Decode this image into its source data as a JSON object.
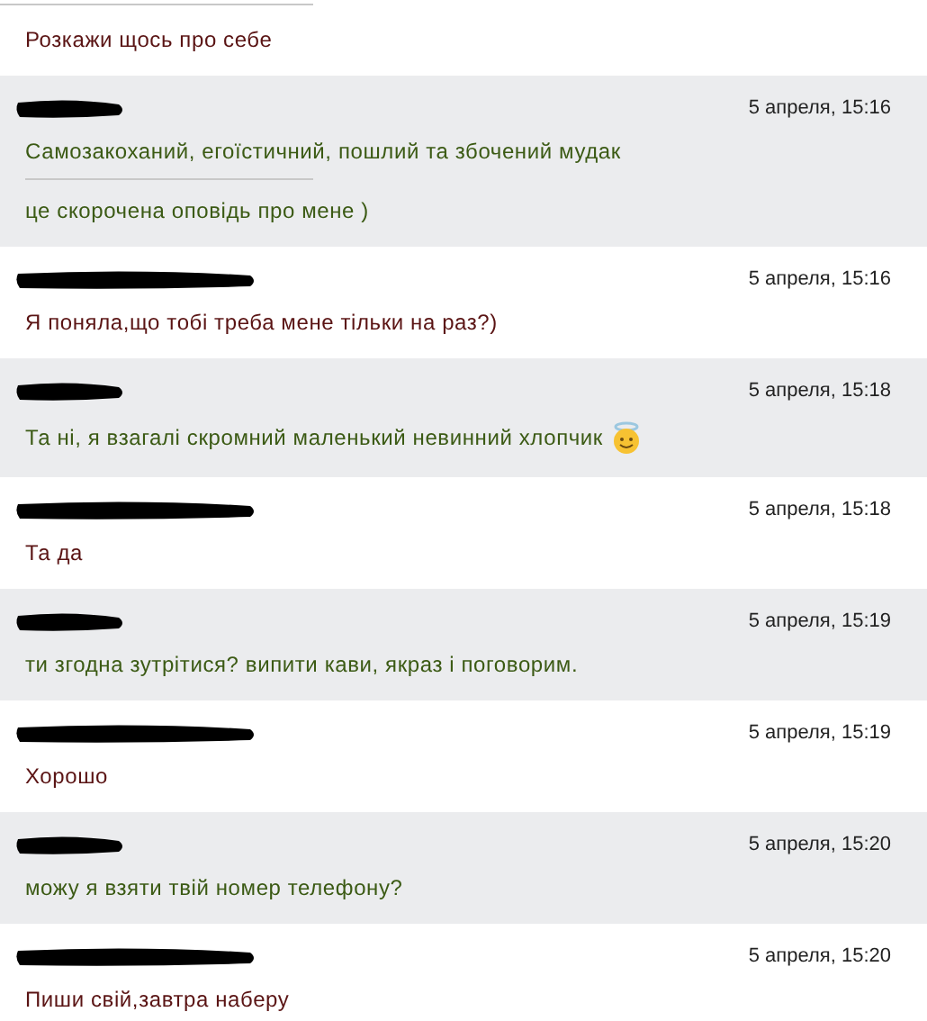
{
  "messages": [
    {
      "kind": "her",
      "cut_top": true,
      "lines": [
        "Розкажи щось про себе"
      ]
    },
    {
      "kind": "him",
      "time": "5 апреля, 15:16",
      "lines": [
        "Самозакоханий, егоїстичний, пошлий та збочений мудак",
        "це скорочена оповідь про мене )"
      ]
    },
    {
      "kind": "her",
      "time": "5 апреля, 15:16",
      "lines": [
        "Я поняла,що тобі треба мене тільки на раз?)"
      ]
    },
    {
      "kind": "him",
      "time": "5 апреля, 15:18",
      "lines": [
        "Та ні, я взагалі скромний маленький невинний хлопчик"
      ],
      "emoji": true
    },
    {
      "kind": "her",
      "time": "5 апреля, 15:18",
      "lines": [
        "Та да"
      ]
    },
    {
      "kind": "him",
      "time": "5 апреля, 15:19",
      "lines": [
        "ти згодна зутрітися? випити кави, якраз і поговорим."
      ]
    },
    {
      "kind": "her",
      "time": "5 апреля, 15:19",
      "lines": [
        "Хорошо"
      ]
    },
    {
      "kind": "him",
      "time": "5 апреля, 15:20",
      "lines": [
        "можу я взяти твій номер телефону?"
      ]
    },
    {
      "kind": "her",
      "time": "5 апреля, 15:20",
      "lines": [
        "Пиши свій,завтра наберу"
      ]
    }
  ]
}
